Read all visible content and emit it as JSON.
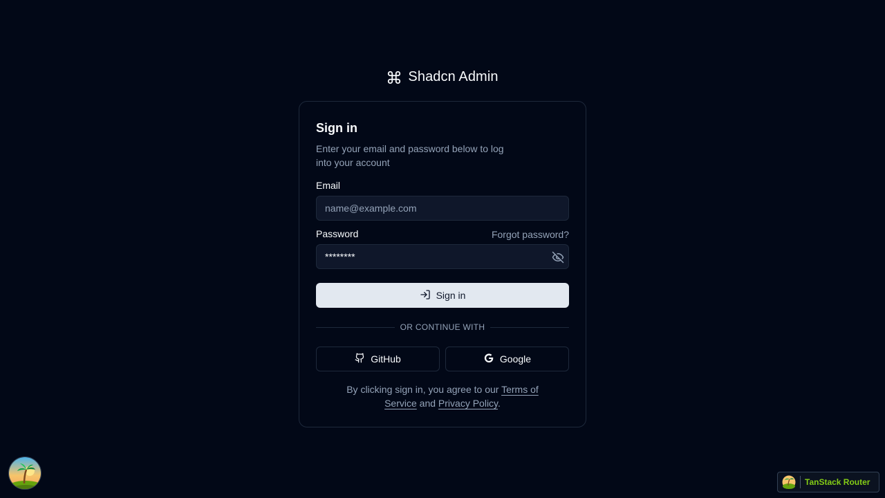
{
  "brand": {
    "title": "Shadcn Admin",
    "icon": "command-icon"
  },
  "card": {
    "title": "Sign in",
    "description": "Enter your email and password below to log into your account"
  },
  "form": {
    "email_label": "Email",
    "email_placeholder": "name@example.com",
    "email_value": "",
    "password_label": "Password",
    "password_value": "********",
    "forgot_label": "Forgot password?",
    "signin_label": "Sign in",
    "divider_text": "OR CONTINUE WITH",
    "github_label": "GitHub",
    "google_label": "Google"
  },
  "terms": {
    "prefix": "By clicking sign in, you agree to our ",
    "tos": "Terms of Service",
    "middle": " and ",
    "privacy": "Privacy Policy",
    "suffix": "."
  },
  "devtools": {
    "router_label": "TanStack Router"
  },
  "colors": {
    "background": "#020817",
    "border": "#1e293b",
    "muted": "#94a3b8",
    "primary_btn": "#e2e8f0",
    "accent": "#84cc16"
  }
}
